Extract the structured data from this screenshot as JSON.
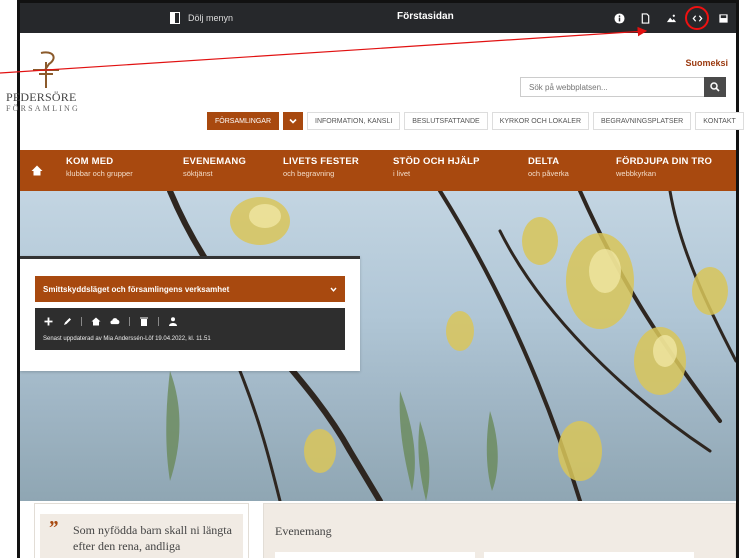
{
  "admin_bar": {
    "toggle_menu_label": "Dölj menyn",
    "page_name": "Förstasidan",
    "icons": [
      "info-icon",
      "page-icon",
      "image-icon",
      "code-icon",
      "save-icon",
      "phone-icon"
    ]
  },
  "header": {
    "logo_name": "PEDERSÖRE",
    "logo_sub": "FÖRSAMLING",
    "language_link": "Suomeksi",
    "search_placeholder": "Sök på webbplatsen..."
  },
  "top_nav": [
    {
      "label": "FÖRSAMLINGAR",
      "active": true
    },
    {
      "label": "INFORMATION, KANSLI"
    },
    {
      "label": "BESLUTSFATTANDE"
    },
    {
      "label": "KYRKOR OCH LOKALER"
    },
    {
      "label": "BEGRAVNINGSPLATSER"
    },
    {
      "label": "KONTAKT"
    }
  ],
  "main_nav": [
    {
      "title": "KOM MED",
      "subtitle": "klubbar och grupper"
    },
    {
      "title": "EVENEMANG",
      "subtitle": "söktjänst"
    },
    {
      "title": "LIVETS FESTER",
      "subtitle": "och begravning"
    },
    {
      "title": "STÖD OCH HJÄLP",
      "subtitle": "i livet"
    },
    {
      "title": "DELTA",
      "subtitle": "och påverka"
    },
    {
      "title": "FÖRDJUPA DIN TRO",
      "subtitle": "webbkyrkan"
    }
  ],
  "info_panel": {
    "accordion_title": "Smittskyddsläget och församlingens verksamhet",
    "updated_text": "Senast uppdaterad av Mia Anderssén-Löf 19.04.2022, kl. 11.51"
  },
  "quote": {
    "text": "Som nyfödda barn skall ni längta efter den rena, andliga"
  },
  "events": {
    "heading": "Evenemang"
  },
  "colors": {
    "brand": "#a8490f",
    "admin_bar": "#26282b",
    "annotation": "#e11111"
  }
}
